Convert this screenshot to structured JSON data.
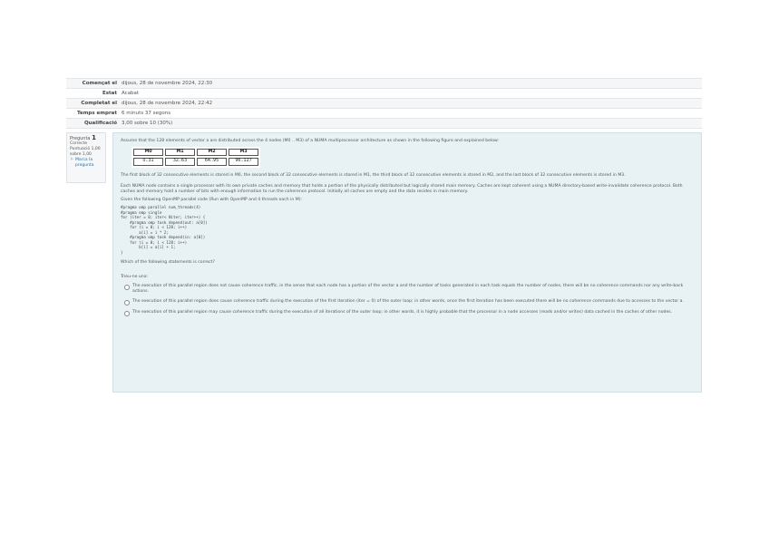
{
  "summary": [
    {
      "label": "Començat el",
      "value": "dijous, 28 de novembre 2024, 22:30"
    },
    {
      "label": "Estat",
      "value": "Acabat"
    },
    {
      "label": "Completat el",
      "value": "dijous, 28 de novembre 2024, 22:42"
    },
    {
      "label": "Temps emprat",
      "value": "6 minuts 37 segons"
    },
    {
      "label": "Qualificació",
      "value": "3,00 sobre 10 (30%)"
    }
  ],
  "question_info": {
    "label": "Pregunta",
    "number": "1",
    "state": "Correcte",
    "mark": "Puntuació 1,00 sobre 1,00",
    "flag_label": "Marca la pregunta"
  },
  "question": {
    "intro": "Assume that the 128 elements of vector a are distributed across the 4 nodes (M0 .. M3) of a NUMA multiprocessor architecture as shown in the following figure and explained below:",
    "table_headers": [
      "M0",
      "M1",
      "M2",
      "M3"
    ],
    "table_values": [
      "0..31",
      "32..63",
      "64..95",
      "96..127"
    ],
    "para1": "The first block of 32 consecutive elements is stored in M0, the second block of 32 consecutive elements is stored in M1, the third block of 32 consecutive elements is stored in M2, and the last block of 32 consecutive elements is stored in M3.",
    "para2": "Each NUMA node contains a single processor with its own private caches and memory that holds a portion of the physically distributed but logically shared main memory. Caches are kept coherent using a NUMA directory-based write-invalidate coherence protocol. Both caches and memory hold a number of bits with enough information to run the coherence protocol. Initially all caches are empty and the data resides in main memory.",
    "para3": "Given the following OpenMP parallel code (Run with OpenMP and 4 threads each in M):",
    "code": "#pragma omp parallel num_threads(4)\n#pragma omp single\nfor (iter = 0; iter< Niter; iter++) {\n    #pragma omp task depend(out: a[0])\n    for (i = 0; i < 128; i++)\n        a[i] = i * 2;\n    #pragma omp task depend(in: a[0])\n    for (i = 0; i < 128; i++)\n        b[i] = a[i] + 1;\n}",
    "prompt": "Which of the following statements is correct?",
    "choose": "Trieu-ne una:",
    "options": [
      "The execution of this parallel region does not cause coherence traffic, in the sense that each node has a portion of the vector a and the number of tasks generated in each task equals the number of nodes, there will be no coherence commands nor any write-back actions.",
      "The execution of this parallel region does cause coherence traffic during the execution of the first iteration (iter = 0) of the outer loop; in other words, once the first iteration has been executed there will be no coherence commands due to accesses to the vector a.",
      "The execution of this parallel region may cause coherence traffic during the execution of all iterations of the outer loop; in other words, it is highly probable that the processor in a node accesses (reads and/or writes) data cached in the caches of other nodes."
    ]
  }
}
